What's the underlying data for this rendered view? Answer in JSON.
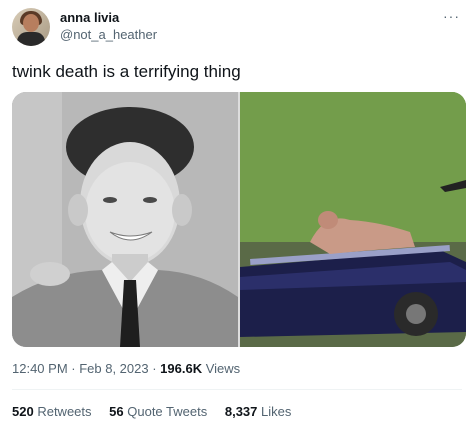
{
  "author": {
    "display_name": "anna livia",
    "handle": "@not_a_heather"
  },
  "more_icon": "···",
  "tweet": {
    "text": "twink death is a terrifying thing"
  },
  "meta": {
    "time": "12:40 PM",
    "separator1": " · ",
    "date": "Feb 8, 2023",
    "separator2": " · ",
    "views_count": "196.6K",
    "views_label": " Views"
  },
  "stats": {
    "retweets_count": "520",
    "retweets_label": "Retweets",
    "quotes_count": "56",
    "quotes_label": "Quote Tweets",
    "likes_count": "8,337",
    "likes_label": "Likes"
  },
  "icons": {
    "more": "more-horizontal-icon"
  }
}
